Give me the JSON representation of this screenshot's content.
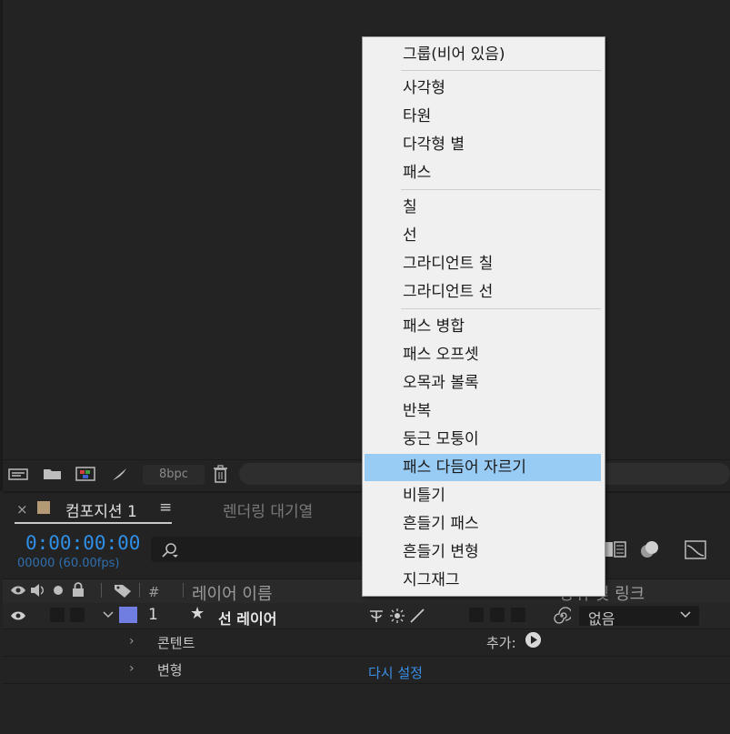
{
  "toolbar": {
    "bpc_label": "8bpc"
  },
  "timeline": {
    "tab_close": "×",
    "tab_title": "컴포지션 1",
    "tab_menu": "≡",
    "tab2_title": "렌더링 대기열",
    "timecode": "0:00:00:00",
    "frames_fps": "00000 (60.00fps)",
    "columns": {
      "hash": "#",
      "layer_name": "레이어 이름",
      "parent_link": "상위 및 링크"
    },
    "layer": {
      "number": "1",
      "star": "★",
      "name": "선 레이어",
      "parent_value": "없음"
    },
    "sub_rows": [
      {
        "arrow": "›",
        "label": "콘텐트",
        "add_label": "추가:"
      },
      {
        "arrow": "›",
        "label": "변형",
        "reset_label": "다시 설정"
      }
    ]
  },
  "menu": {
    "items": [
      {
        "label": "그룹(비어 있음)"
      },
      {
        "label": "사각형"
      },
      {
        "label": "타원"
      },
      {
        "label": "다각형 별"
      },
      {
        "label": "패스"
      },
      {
        "label": "칠"
      },
      {
        "label": "선"
      },
      {
        "label": "그라디언트 칠"
      },
      {
        "label": "그라디언트 선"
      },
      {
        "label": "패스 병합"
      },
      {
        "label": "패스 오프셋"
      },
      {
        "label": "오목과 볼록"
      },
      {
        "label": "반복"
      },
      {
        "label": "둥근 모퉁이"
      },
      {
        "label": "패스 다듬어 자르기",
        "highlighted": true
      },
      {
        "label": "비틀기"
      },
      {
        "label": "흔들기 패스"
      },
      {
        "label": "흔들기 변형"
      },
      {
        "label": "지그재그"
      }
    ]
  },
  "colors": {
    "accent_blue": "#2f8fe6",
    "menu_highlight": "#99ccf5",
    "layer_label": "#6f7ee0",
    "comp_swatch": "#b39a74"
  }
}
